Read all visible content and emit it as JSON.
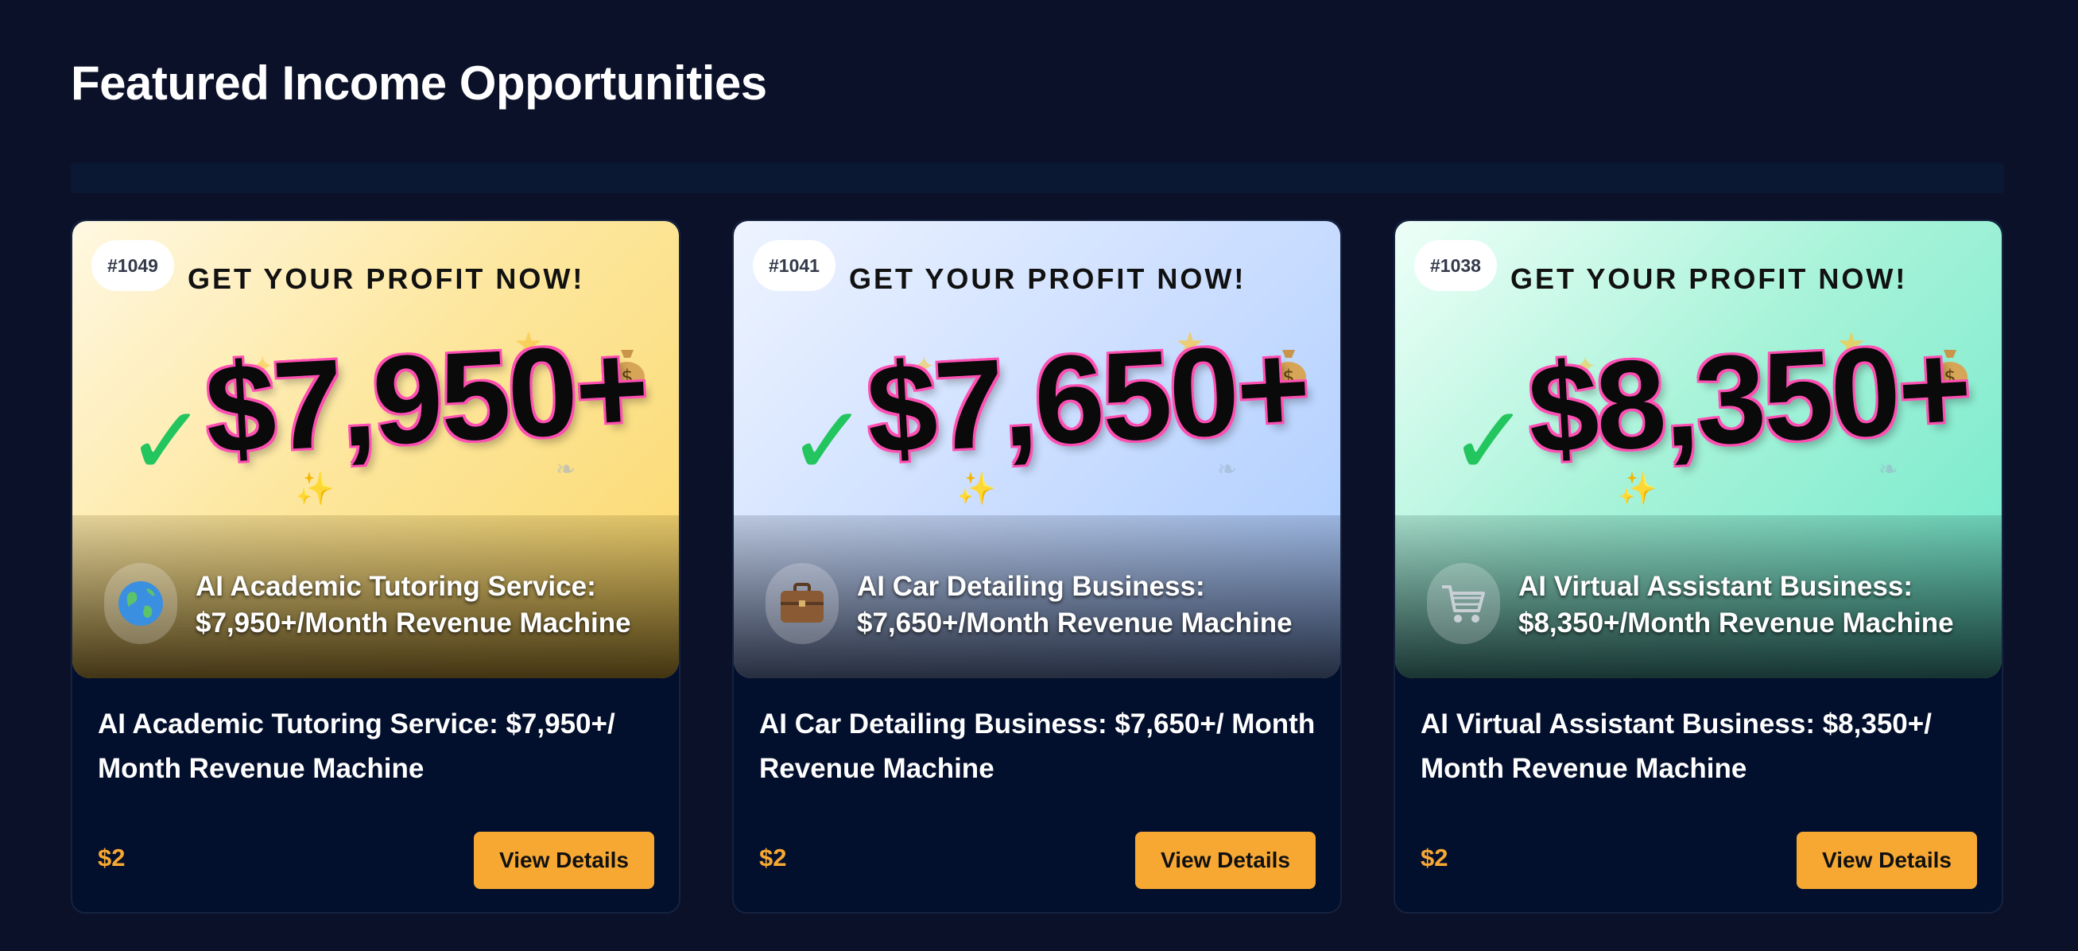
{
  "section": {
    "title": "Featured Income Opportunities"
  },
  "cards": [
    {
      "id": "#1049",
      "headline": "GET YOUR PROFIT NOW!",
      "amount": "$7,950+",
      "theme": "gold",
      "icon": "globe-icon",
      "hero_title_line1": "AI Academic Tutoring Service:",
      "hero_title_line2": "$7,950+/Month Revenue Machine",
      "title": "AI Academic Tutoring Service: $7,950+/ Month Revenue Machine",
      "price": "$2",
      "button_label": "View Details"
    },
    {
      "id": "#1041",
      "headline": "GET YOUR PROFIT NOW!",
      "amount": "$7,650+",
      "theme": "blue",
      "icon": "briefcase-icon",
      "hero_title_line1": "AI Car Detailing Business:",
      "hero_title_line2": "$7,650+/Month Revenue Machine",
      "title": "AI Car Detailing Business: $7,650+/ Month Revenue Machine",
      "price": "$2",
      "button_label": "View Details"
    },
    {
      "id": "#1038",
      "headline": "GET YOUR PROFIT NOW!",
      "amount": "$8,350+",
      "theme": "mint",
      "icon": "shopping-cart-icon",
      "hero_title_line1": "AI Virtual Assistant Business:",
      "hero_title_line2": "$8,350+/Month Revenue Machine",
      "title": "AI Virtual Assistant Business: $8,350+/ Month Revenue Machine",
      "price": "$2",
      "button_label": "View Details"
    }
  ],
  "colors": {
    "background": "#0b1129",
    "card_background": "#020f2d",
    "accent_orange": "#f7a833",
    "check_green": "#22c55e",
    "amount_outline_pink": "#ff4fb3"
  }
}
